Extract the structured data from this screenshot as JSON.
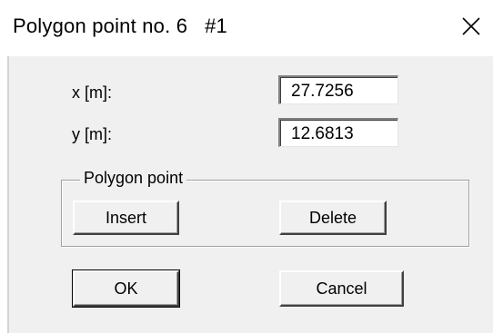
{
  "window": {
    "title": "Polygon point no. 6   #1",
    "close_icon": "close-icon"
  },
  "fields": {
    "x": {
      "label": "x [m]:",
      "value": "27.7256"
    },
    "y": {
      "label": "y [m]:",
      "value": "12.6813"
    }
  },
  "polygon_group": {
    "label": "Polygon point",
    "insert_label": "Insert",
    "delete_label": "Delete"
  },
  "actions": {
    "ok_label": "OK",
    "cancel_label": "Cancel"
  },
  "colors": {
    "titlebar": "#ffffff",
    "client": "#f0f0f0",
    "input_bg": "#ffffff"
  }
}
